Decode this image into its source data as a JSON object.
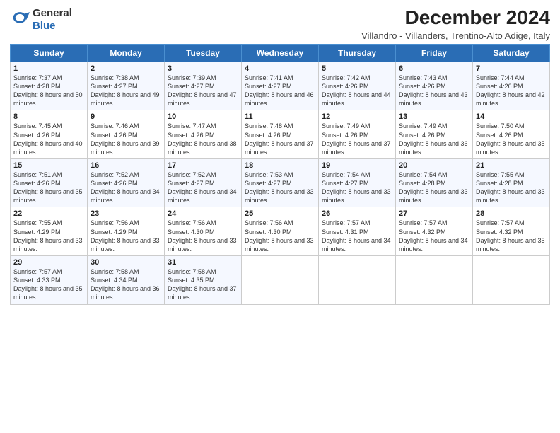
{
  "header": {
    "logo_general": "General",
    "logo_blue": "Blue",
    "title": "December 2024",
    "subtitle": "Villandro - Villanders, Trentino-Alto Adige, Italy"
  },
  "columns": [
    "Sunday",
    "Monday",
    "Tuesday",
    "Wednesday",
    "Thursday",
    "Friday",
    "Saturday"
  ],
  "weeks": [
    [
      {
        "day": "1",
        "sunrise": "7:37 AM",
        "sunset": "4:28 PM",
        "daylight": "8 hours and 50 minutes."
      },
      {
        "day": "2",
        "sunrise": "7:38 AM",
        "sunset": "4:27 PM",
        "daylight": "8 hours and 49 minutes."
      },
      {
        "day": "3",
        "sunrise": "7:39 AM",
        "sunset": "4:27 PM",
        "daylight": "8 hours and 47 minutes."
      },
      {
        "day": "4",
        "sunrise": "7:41 AM",
        "sunset": "4:27 PM",
        "daylight": "8 hours and 46 minutes."
      },
      {
        "day": "5",
        "sunrise": "7:42 AM",
        "sunset": "4:26 PM",
        "daylight": "8 hours and 44 minutes."
      },
      {
        "day": "6",
        "sunrise": "7:43 AM",
        "sunset": "4:26 PM",
        "daylight": "8 hours and 43 minutes."
      },
      {
        "day": "7",
        "sunrise": "7:44 AM",
        "sunset": "4:26 PM",
        "daylight": "8 hours and 42 minutes."
      }
    ],
    [
      {
        "day": "8",
        "sunrise": "7:45 AM",
        "sunset": "4:26 PM",
        "daylight": "8 hours and 40 minutes."
      },
      {
        "day": "9",
        "sunrise": "7:46 AM",
        "sunset": "4:26 PM",
        "daylight": "8 hours and 39 minutes."
      },
      {
        "day": "10",
        "sunrise": "7:47 AM",
        "sunset": "4:26 PM",
        "daylight": "8 hours and 38 minutes."
      },
      {
        "day": "11",
        "sunrise": "7:48 AM",
        "sunset": "4:26 PM",
        "daylight": "8 hours and 37 minutes."
      },
      {
        "day": "12",
        "sunrise": "7:49 AM",
        "sunset": "4:26 PM",
        "daylight": "8 hours and 37 minutes."
      },
      {
        "day": "13",
        "sunrise": "7:49 AM",
        "sunset": "4:26 PM",
        "daylight": "8 hours and 36 minutes."
      },
      {
        "day": "14",
        "sunrise": "7:50 AM",
        "sunset": "4:26 PM",
        "daylight": "8 hours and 35 minutes."
      }
    ],
    [
      {
        "day": "15",
        "sunrise": "7:51 AM",
        "sunset": "4:26 PM",
        "daylight": "8 hours and 35 minutes."
      },
      {
        "day": "16",
        "sunrise": "7:52 AM",
        "sunset": "4:26 PM",
        "daylight": "8 hours and 34 minutes."
      },
      {
        "day": "17",
        "sunrise": "7:52 AM",
        "sunset": "4:27 PM",
        "daylight": "8 hours and 34 minutes."
      },
      {
        "day": "18",
        "sunrise": "7:53 AM",
        "sunset": "4:27 PM",
        "daylight": "8 hours and 33 minutes."
      },
      {
        "day": "19",
        "sunrise": "7:54 AM",
        "sunset": "4:27 PM",
        "daylight": "8 hours and 33 minutes."
      },
      {
        "day": "20",
        "sunrise": "7:54 AM",
        "sunset": "4:28 PM",
        "daylight": "8 hours and 33 minutes."
      },
      {
        "day": "21",
        "sunrise": "7:55 AM",
        "sunset": "4:28 PM",
        "daylight": "8 hours and 33 minutes."
      }
    ],
    [
      {
        "day": "22",
        "sunrise": "7:55 AM",
        "sunset": "4:29 PM",
        "daylight": "8 hours and 33 minutes."
      },
      {
        "day": "23",
        "sunrise": "7:56 AM",
        "sunset": "4:29 PM",
        "daylight": "8 hours and 33 minutes."
      },
      {
        "day": "24",
        "sunrise": "7:56 AM",
        "sunset": "4:30 PM",
        "daylight": "8 hours and 33 minutes."
      },
      {
        "day": "25",
        "sunrise": "7:56 AM",
        "sunset": "4:30 PM",
        "daylight": "8 hours and 33 minutes."
      },
      {
        "day": "26",
        "sunrise": "7:57 AM",
        "sunset": "4:31 PM",
        "daylight": "8 hours and 34 minutes."
      },
      {
        "day": "27",
        "sunrise": "7:57 AM",
        "sunset": "4:32 PM",
        "daylight": "8 hours and 34 minutes."
      },
      {
        "day": "28",
        "sunrise": "7:57 AM",
        "sunset": "4:32 PM",
        "daylight": "8 hours and 35 minutes."
      }
    ],
    [
      {
        "day": "29",
        "sunrise": "7:57 AM",
        "sunset": "4:33 PM",
        "daylight": "8 hours and 35 minutes."
      },
      {
        "day": "30",
        "sunrise": "7:58 AM",
        "sunset": "4:34 PM",
        "daylight": "8 hours and 36 minutes."
      },
      {
        "day": "31",
        "sunrise": "7:58 AM",
        "sunset": "4:35 PM",
        "daylight": "8 hours and 37 minutes."
      },
      null,
      null,
      null,
      null
    ]
  ],
  "labels": {
    "sunrise": "Sunrise:",
    "sunset": "Sunset:",
    "daylight": "Daylight:"
  }
}
